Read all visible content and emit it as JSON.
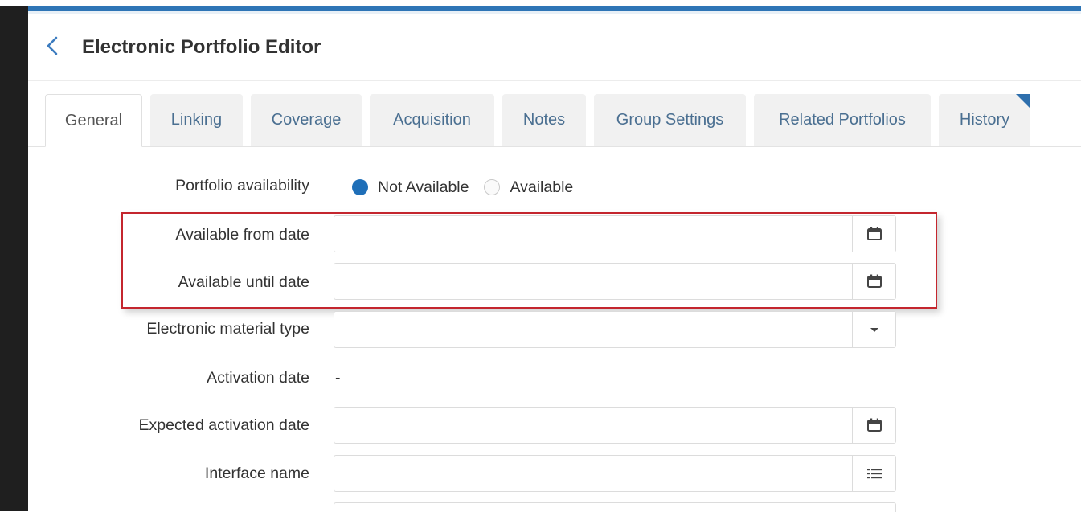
{
  "header": {
    "title": "Electronic Portfolio Editor"
  },
  "tabs": [
    {
      "label": "General",
      "active": true
    },
    {
      "label": "Linking"
    },
    {
      "label": "Coverage"
    },
    {
      "label": "Acquisition"
    },
    {
      "label": "Notes"
    },
    {
      "label": "Group Settings"
    },
    {
      "label": "Related Portfolios"
    },
    {
      "label": "History"
    }
  ],
  "form": {
    "availability": {
      "label": "Portfolio availability",
      "options": [
        {
          "label": "Not Available",
          "selected": true
        },
        {
          "label": "Available",
          "selected": false
        }
      ]
    },
    "available_from": {
      "label": "Available from date",
      "value": "",
      "icon": "calendar-icon"
    },
    "available_until": {
      "label": "Available until date",
      "value": "",
      "icon": "calendar-icon"
    },
    "material_type": {
      "label": "Electronic material type",
      "value": "",
      "icon": "caret-down-icon"
    },
    "activation_date": {
      "label": "Activation date",
      "value": "-"
    },
    "expected_activation": {
      "label": "Expected activation date",
      "value": "",
      "icon": "calendar-icon"
    },
    "interface_name": {
      "label": "Interface name",
      "value": "",
      "icon": "list-icon"
    }
  },
  "colors": {
    "accent": "#2e75b6",
    "highlight_border": "#c4262e",
    "radio_selected": "#1f6fb8"
  }
}
